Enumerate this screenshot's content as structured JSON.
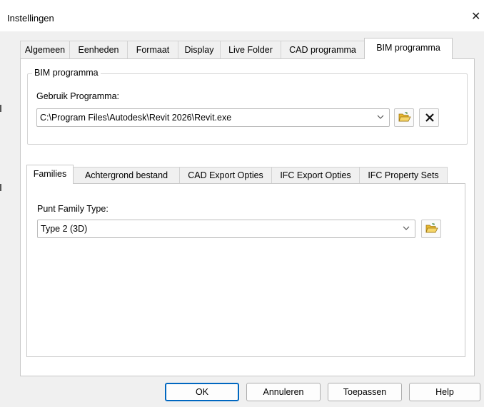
{
  "window": {
    "title": "Instellingen",
    "close_glyph": "✕"
  },
  "tabs": [
    {
      "label": "Algemeen"
    },
    {
      "label": "Eenheden"
    },
    {
      "label": "Formaat"
    },
    {
      "label": "Display"
    },
    {
      "label": "Live Folder"
    },
    {
      "label": "CAD programma"
    },
    {
      "label": "BIM programma"
    }
  ],
  "active_tab": "BIM programma",
  "bim_group": {
    "title": "BIM programma",
    "program_label": "Gebruik Programma:",
    "program_path": "C:\\Program Files\\Autodesk\\Revit 2026\\Revit.exe",
    "browse_icon": "folder-open-icon",
    "clear_icon": "close-x-icon"
  },
  "subtabs": [
    {
      "label": "Families"
    },
    {
      "label": "Achtergrond bestand"
    },
    {
      "label": "CAD Export Opties"
    },
    {
      "label": "IFC Export Opties"
    },
    {
      "label": "IFC Property Sets"
    }
  ],
  "active_subtab": "Families",
  "families": {
    "punt_label": "Punt Family Type:",
    "punt_value": "Type 2 (3D)",
    "browse_icon": "folder-open-icon"
  },
  "buttons": {
    "ok": "OK",
    "cancel": "Annuleren",
    "apply": "Toepassen",
    "help": "Help"
  },
  "colors": {
    "accent": "#0067c0",
    "folder": "#e8b830"
  }
}
